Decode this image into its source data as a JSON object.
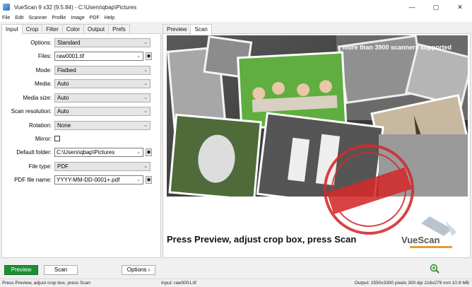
{
  "window": {
    "title": "VueScan 9 x32 (9.5.84) - C:\\Users\\qbap\\Pictures",
    "minimize": "—",
    "maximize": "▢",
    "close": "✕"
  },
  "menu": [
    "File",
    "Edit",
    "Scanner",
    "Profile",
    "Image",
    "PDF",
    "Help"
  ],
  "left_tabs": [
    "Input",
    "Crop",
    "Filter",
    "Color",
    "Output",
    "Prefs"
  ],
  "right_tabs": [
    "Preview",
    "Scan"
  ],
  "settings": [
    {
      "label": "Options:",
      "value": "Standard",
      "kind": "select"
    },
    {
      "label": "Files:",
      "value": "raw0001.tif",
      "kind": "combo"
    },
    {
      "label": "Mode:",
      "value": "Flatbed",
      "kind": "select"
    },
    {
      "label": "Media:",
      "value": "Auto",
      "kind": "select"
    },
    {
      "label": "Media size:",
      "value": "Auto",
      "kind": "select"
    },
    {
      "label": "Scan resolution:",
      "value": "Auto",
      "kind": "select"
    },
    {
      "label": "Rotation:",
      "value": "None",
      "kind": "select"
    },
    {
      "label": "Mirror:",
      "value": "",
      "kind": "checkbox"
    },
    {
      "label": "Default folder:",
      "value": "C:\\Users\\qbap\\Pictures",
      "kind": "combo"
    },
    {
      "label": "File type:",
      "value": "PDF",
      "kind": "select"
    },
    {
      "label": "PDF file name:",
      "value": "YYYY-MM-DD-0001+.pdf",
      "kind": "combo"
    }
  ],
  "preview": {
    "caption": "more than 3900 scanners supported",
    "instruction": "Press Preview, adjust crop box, press Scan",
    "watermark_logo": "VueScan"
  },
  "buttons": {
    "preview": "Preview",
    "scan": "Scan",
    "options": "Options ›"
  },
  "status": {
    "left": "Press Preview, adjust crop box, press Scan",
    "middle": "Input: raw0001.tif",
    "right": "Output: 2550x3300 pixels 300 dpi 216x279 mm 10.9 MB"
  },
  "colors": {
    "preview_button": "#1e8f34",
    "stamp_red": "#d42a2a"
  }
}
